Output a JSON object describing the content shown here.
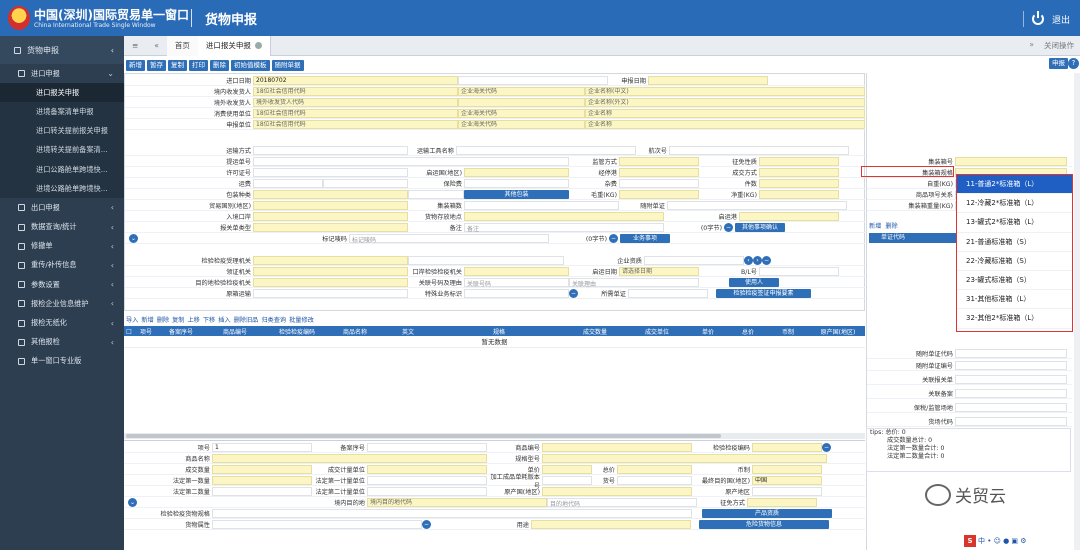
{
  "app": {
    "brand_cn": "中国(深圳)国际贸易单一窗口",
    "brand_en": "China International Trade Single Window",
    "module": "货物申报",
    "exit_label": "退出"
  },
  "sidebar": {
    "header": "货物申报",
    "items": [
      {
        "label": "进口申报",
        "level": 1
      },
      {
        "label": "进口报关申报",
        "level": 2,
        "active": true
      },
      {
        "label": "进境备案清单申报",
        "level": 2
      },
      {
        "label": "进口转关提前报关申报",
        "level": 2
      },
      {
        "label": "进境转关提前备案清...",
        "level": 2
      },
      {
        "label": "进口公路舱单跨境快...",
        "level": 2
      },
      {
        "label": "进境公路舱单跨境快...",
        "level": 2
      },
      {
        "label": "出口申报",
        "level": 1
      },
      {
        "label": "数据查询/统计",
        "level": 1
      },
      {
        "label": "修撤单",
        "level": 1
      },
      {
        "label": "重传/补传信息",
        "level": 1
      },
      {
        "label": "参数设置",
        "level": 1
      },
      {
        "label": "报检企业信息维护",
        "level": 1
      },
      {
        "label": "报检无纸化",
        "level": 1
      },
      {
        "label": "其他报检",
        "level": 1
      },
      {
        "label": "单一窗口专业版",
        "level": 1
      }
    ]
  },
  "tabs": {
    "home": "首页",
    "current": "进口报关申报",
    "close_ops": "关闭操作"
  },
  "toolbar": {
    "buttons": [
      "新增",
      "暂存",
      "复制",
      "打印",
      "删除",
      "初始值模板",
      "随附单据"
    ],
    "declare": "申报"
  },
  "form": {
    "import_date_label": "进口日期",
    "import_date_value": "20180702",
    "declare_date_label": "申报日期",
    "rows": [
      {
        "label": "境内收发货人",
        "value": "18位社会信用代码",
        "mid_label": "企业海关代码",
        "right_label": "企业名称(中文)"
      },
      {
        "label": "境外收发货人",
        "value": "境外收发货人代码",
        "mid_label": "",
        "right_label": "企业名称(外文)"
      },
      {
        "label": "消费使用单位",
        "value": "18位社会信用代码",
        "mid_label": "企业海关代码",
        "right_label": "企业名称"
      },
      {
        "label": "申报单位",
        "value": "18位社会信用代码",
        "mid_label": "企业海关代码",
        "right_label": "企业名称"
      }
    ],
    "transport_mode": "运输方式",
    "transport_name": "运输工具名称",
    "voyage": "航次号",
    "bill_no": "提运单号",
    "supervision": "监管方式",
    "tax_nature": "征免性质",
    "license_no": "许可证号",
    "origin_port": "启运国(地区)",
    "stop_port": "经停港",
    "deal_mode": "成交方式",
    "freight": "运费",
    "insurance": "保险费",
    "misc_fee": "杂费",
    "pieces": "件数",
    "pack_type": "包装种类",
    "other_pack": "其他包装",
    "gross_weight": "毛重(KG)",
    "net_weight": "净重(KG)",
    "trade_country": "贸易国别(地区)",
    "container_count": "集装箱数",
    "attached_docs": "随附单证",
    "entry_port": "入境口岸",
    "goods_location": "货物存放地点",
    "departure_port": "启运港",
    "customs_type": "报关单类型",
    "remark_label": "备注",
    "remark_ph": "备注",
    "remark_chars": "(0字节)",
    "other_confirm": "其他事项确认",
    "mark_no": "标记唛码",
    "mark_ph": "标记唛码",
    "mark_chars": "(0字节)",
    "business_items": "业务事项",
    "inspect_authority": "检验检疫受理机关",
    "enterprise_qual": "企业资质",
    "port_authority": "领证机关",
    "port_inspect": "口岸检验检疫机关",
    "departure_date": "启运日期",
    "departure_date_ph": "请选择日期",
    "bl_no": "B/L号",
    "dest_authority": "目的地检验检疫机关",
    "related_doc": "关联号码及理由",
    "related_doc_ph": "关联号码",
    "related_reason_ph": "关联理由",
    "user": "使用人",
    "origin_sensitive": "原箱运输",
    "special_business": "特殊业务标识",
    "required_cert": "所需单证",
    "inspect_elements": "检验检疫签证申报要素"
  },
  "grid": {
    "toolbar": [
      "导入",
      "新增",
      "删除",
      "复制",
      "上移",
      "下移",
      "插入",
      "删除旧品",
      "归类查询",
      "批量修改"
    ],
    "columns": [
      "项号",
      "备案序号",
      "商品编号",
      "检验检疫编码",
      "商品名称",
      "英文",
      "规格",
      "成交数量",
      "成交单位",
      "单价",
      "总价",
      "币制",
      "原产国(地区)"
    ],
    "empty": "暂无数据"
  },
  "detail": {
    "item_no": "项号",
    "item_no_value": "1",
    "record_no": "备案序号",
    "goods_code": "商品编号",
    "inspect_code": "检验检疫编码",
    "goods_name": "商品名称",
    "spec": "规格型号",
    "deal_qty": "成交数量",
    "deal_unit": "成交计量单位",
    "price": "单价",
    "total": "总价",
    "currency": "币制",
    "legal_qty1": "法定第一数量",
    "legal_unit1": "法定第一计量单位",
    "process_version": "加工成品单耗版本号",
    "goods_no": "货号",
    "final_dest": "最终目的国(地区)",
    "final_dest_value": "中国",
    "legal_qty2": "法定第二数量",
    "legal_unit2": "法定第二计量单位",
    "origin_country": "原产国(地区)",
    "origin_area": "原产地区",
    "dest_area": "境内目的地",
    "dest_area_ph": "境内目的地代码",
    "dest_code_ph": "目的地代码",
    "tax_mode": "征免方式",
    "inspect_spec": "检验检疫货物规格",
    "product_qual": "产品资质",
    "goods_attr": "货物属性",
    "usage": "用途",
    "hazard": "危险货物信息"
  },
  "rightpanel": {
    "container_no": "集装箱号",
    "container_spec": "集装箱规格",
    "self_weight": "自重(KG)",
    "goods_item": "商品项号关系",
    "container_weight": "集装箱重量(KG)",
    "add": "新增",
    "delete": "删除",
    "cert_tab": "单证代码",
    "attached_cert": "随附单证代码",
    "attached_no": "随附单证编号",
    "related_decl": "关联报关单",
    "related_record": "关联备案",
    "bonded_place": "保税/监管场地",
    "yard_code": "货场代码",
    "tips": [
      "tips: 总价: 0",
      "成交数量总计: 0",
      "法定第一数量合计: 0",
      "法定第二数量合计: 0"
    ]
  },
  "dropdown": {
    "options": [
      "11-普通2*标准箱（L）",
      "12-冷藏2*标准箱（L）",
      "13-罐式2*标准箱（L）",
      "21-普通标准箱（S）",
      "22-冷藏标准箱（S）",
      "23-罐式标准箱（S）",
      "31-其他标准箱（L）",
      "32-其他2*标准箱（L）"
    ],
    "selected_index": 0
  },
  "watermark": "关贸云",
  "colors": {
    "topbar": "#2a6bb8",
    "sidebar": "#2c3e50",
    "accent": "#2f6fb8",
    "field_fill": "#fbf6c4",
    "highlight": "#e23232"
  }
}
